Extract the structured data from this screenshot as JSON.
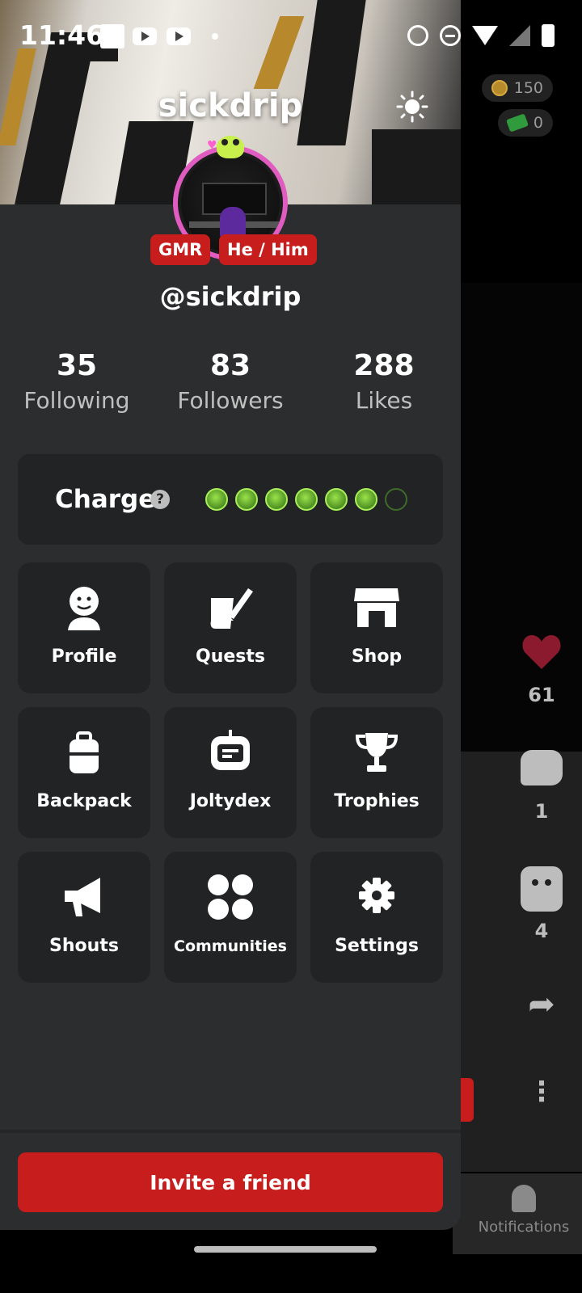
{
  "status_bar": {
    "time": "11:46"
  },
  "wallet": {
    "coins": "150",
    "cash": "0"
  },
  "post_actions": {
    "likes": "61",
    "comments": "1",
    "stickers": "4"
  },
  "bottom_nav": {
    "notifications_label": "Notifications"
  },
  "profile": {
    "display_name": "sickdrip",
    "handle": "@sickdrip",
    "tags": [
      "GMR",
      "He / Him"
    ],
    "ring_color": "#e05cc0"
  },
  "stats": [
    {
      "value": "35",
      "label": "Following"
    },
    {
      "value": "83",
      "label": "Followers"
    },
    {
      "value": "288",
      "label": "Likes"
    }
  ],
  "charge": {
    "label": "Charge",
    "filled": 6,
    "total": 7,
    "help_icon": "question-circle-icon"
  },
  "menu": [
    {
      "label": "Profile",
      "icon": "profile-face-icon"
    },
    {
      "label": "Quests",
      "icon": "quest-scroll-icon"
    },
    {
      "label": "Shop",
      "icon": "storefront-icon"
    },
    {
      "label": "Backpack",
      "icon": "backpack-icon"
    },
    {
      "label": "Joltydex",
      "icon": "joltydex-robot-icon"
    },
    {
      "label": "Trophies",
      "icon": "trophy-icon"
    },
    {
      "label": "Shouts",
      "icon": "megaphone-icon"
    },
    {
      "label": "Communities",
      "icon": "communities-dots-icon"
    },
    {
      "label": "Settings",
      "icon": "gear-icon"
    }
  ],
  "invite": {
    "label": "Invite a friend"
  },
  "colors": {
    "accent": "#c81d1d",
    "panel": "#2c2d2e",
    "card": "#222324",
    "charge_green": "#9be34a"
  }
}
